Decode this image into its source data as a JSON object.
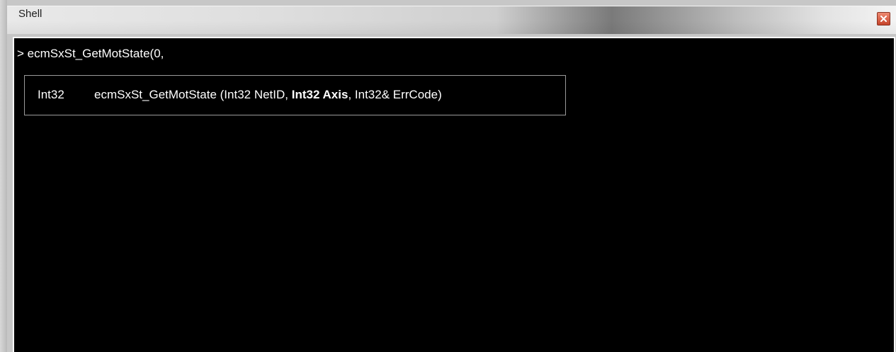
{
  "window": {
    "title": "Shell",
    "close_icon": "close-icon"
  },
  "console": {
    "prompt_text": "> ecmSxSt_GetMotState(0,"
  },
  "signature_tip": {
    "return_type": "Int32",
    "func_name": "ecmSxSt_GetMotState (",
    "param1": "Int32 NetID",
    "sep1": ", ",
    "param2_active": "Int32 Axis",
    "sep2": ", ",
    "param3": "Int32& ErrCode",
    "close": ")"
  },
  "colors": {
    "console_bg": "#000000",
    "console_text": "#ffffff",
    "close_button": "#d0553a"
  }
}
